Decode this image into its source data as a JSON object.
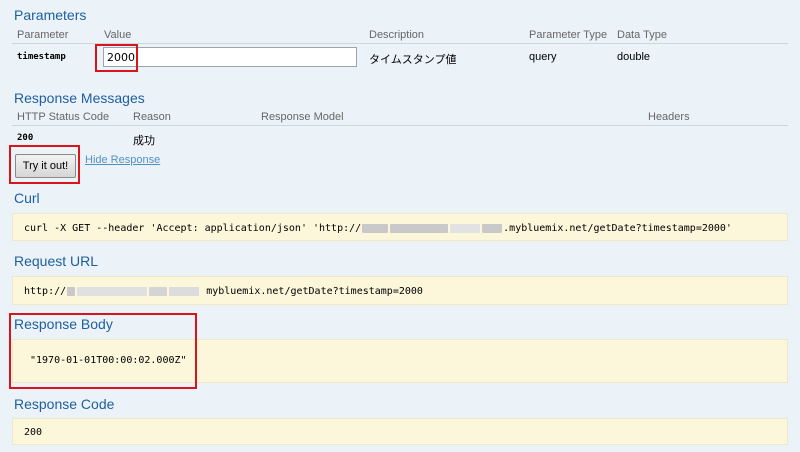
{
  "parameters": {
    "title": "Parameters",
    "headers": {
      "parameter": "Parameter",
      "value": "Value",
      "description": "Description",
      "param_type": "Parameter Type",
      "data_type": "Data Type"
    },
    "row": {
      "name": "timestamp",
      "value": "2000",
      "description": "タイムスタンプ値",
      "param_type": "query",
      "data_type": "double"
    }
  },
  "response_messages": {
    "title": "Response Messages",
    "headers": {
      "status_code": "HTTP Status Code",
      "reason": "Reason",
      "model": "Response Model",
      "headers": "Headers"
    },
    "row": {
      "status_code": "200",
      "reason": "成功"
    }
  },
  "actions": {
    "try_label": "Try it out!",
    "hide_label": "Hide Response"
  },
  "curl": {
    "title": "Curl",
    "prefix": "curl -X GET --header 'Accept: application/json' 'http://",
    "suffix": ".mybluemix.net/getDate?timestamp=2000'"
  },
  "request_url": {
    "title": "Request URL",
    "prefix": "http://",
    "suffix": "mybluemix.net/getDate?timestamp=2000"
  },
  "response_body": {
    "title": "Response Body",
    "value": "\"1970-01-01T00:00:02.000Z\""
  },
  "response_code": {
    "title": "Response Code",
    "value": "200"
  },
  "colors": {
    "heading": "#1f5fa0",
    "code_bg": "#fcf6db",
    "highlight": "#d9141b",
    "page_bg": "#ebf3f9"
  }
}
